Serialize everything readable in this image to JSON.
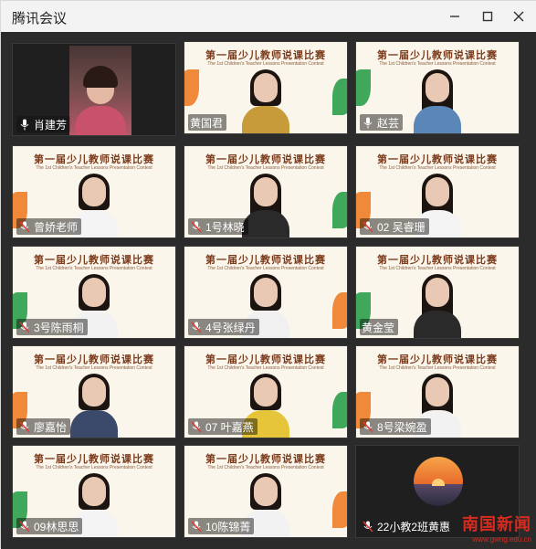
{
  "window": {
    "title": "腾讯会议"
  },
  "slide": {
    "title_cn": "第一届少儿教师说课比赛",
    "title_en": "The 1st Children's Teacher Lessons Presentation Contest"
  },
  "participants": [
    {
      "name": "肖建芳"
    },
    {
      "name": "黄国君"
    },
    {
      "name": "赵芸"
    },
    {
      "name": "曾娇老师"
    },
    {
      "name": "1号林晓"
    },
    {
      "name": "02 吴睿珊"
    },
    {
      "name": "3号陈雨桐"
    },
    {
      "name": "4号张绿丹"
    },
    {
      "name": "黄金莹"
    },
    {
      "name": "廖嘉怡"
    },
    {
      "name": "07 叶嘉燕"
    },
    {
      "name": "8号梁婉盈"
    },
    {
      "name": "09林思思"
    },
    {
      "name": "10陈锦菁"
    },
    {
      "name": "22小教2班黄惠"
    }
  ],
  "watermark": {
    "text": "南国新闻",
    "url": "www.gwng.edu.cn"
  },
  "colors": {
    "accent_green": "#2e9b4a",
    "brand_red": "#d62b1f"
  }
}
